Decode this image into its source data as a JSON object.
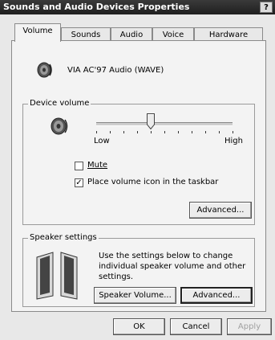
{
  "window": {
    "title": "Sounds and Audio Devices Properties",
    "help_label": "?"
  },
  "tabs": [
    {
      "label": "Volume",
      "active": true
    },
    {
      "label": "Sounds",
      "active": false
    },
    {
      "label": "Audio",
      "active": false
    },
    {
      "label": "Voice",
      "active": false
    },
    {
      "label": "Hardware",
      "active": false
    }
  ],
  "device": {
    "name": "VIA AC'97 Audio (WAVE)",
    "icon": "speaker-icon"
  },
  "device_volume": {
    "group_label": "Device volume",
    "low_label": "Low",
    "high_label": "High",
    "level": 0.4,
    "mute": {
      "label": "Mute",
      "checked": false
    },
    "taskbar": {
      "label": "Place volume icon in the taskbar",
      "checked": true
    },
    "advanced_label": "Advanced..."
  },
  "speaker_settings": {
    "group_label": "Speaker settings",
    "description": "Use the settings below to change individual speaker volume and other settings.",
    "speaker_volume_label": "Speaker Volume...",
    "advanced_label": "Advanced..."
  },
  "footer": {
    "ok_label": "OK",
    "cancel_label": "Cancel",
    "apply_label": "Apply"
  }
}
